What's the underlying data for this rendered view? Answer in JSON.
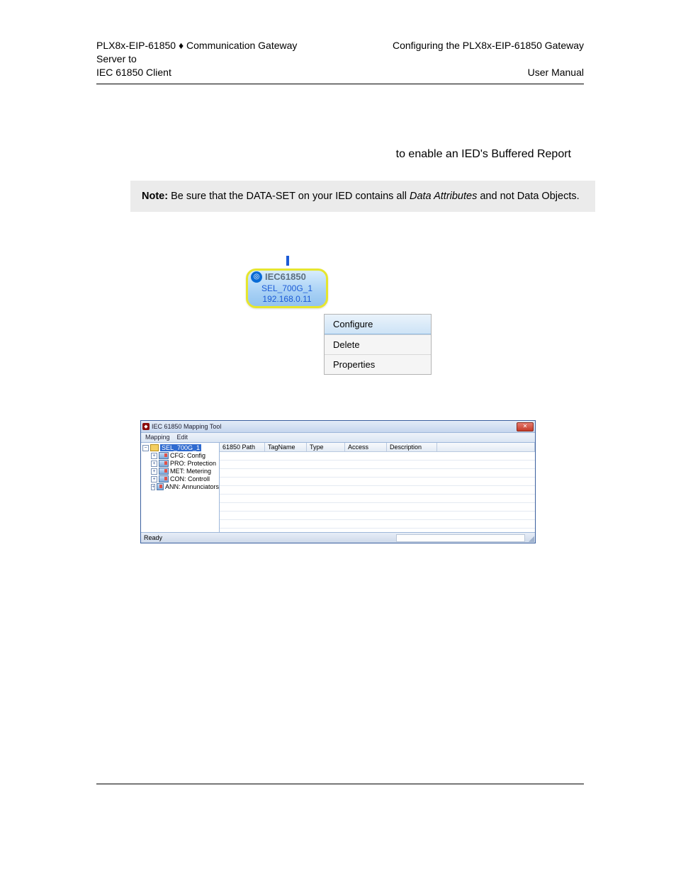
{
  "header": {
    "left_line1_a": "PLX8x-EIP-61850",
    "left_line1_b": "Communication Gateway",
    "left_line2": "Server to",
    "left_line3": "IEC 61850 Client",
    "right_line1": "Configuring the PLX8x-EIP-61850 Gateway",
    "right_line3": "User Manual",
    "diamond": "♦"
  },
  "section_heading": "to enable an IED's Buffered Report",
  "note": {
    "prefix": "Note:",
    "before_italic": " Be sure that the DATA-SET on your IED contains all ",
    "italic": "Data Attributes",
    "after_italic": " and not Data Objects."
  },
  "ied_node": {
    "title": "IEC61850",
    "name": "SEL_700G_1",
    "ip": "192.168.0.11"
  },
  "context_menu": {
    "items": [
      "Configure",
      "Delete",
      "Properties"
    ]
  },
  "mapping_tool": {
    "title": "IEC 61850 Mapping Tool",
    "menus": [
      "Mapping",
      "Edit"
    ],
    "tree": {
      "root": "SEL_700G_1",
      "children": [
        "CFG: Config",
        "PRO: Protection",
        "MET: Metering",
        "CON: Controll",
        "ANN: Annunciators"
      ]
    },
    "columns": [
      "61850 Path",
      "TagName",
      "Type",
      "Access",
      "Description"
    ],
    "status": "Ready"
  }
}
